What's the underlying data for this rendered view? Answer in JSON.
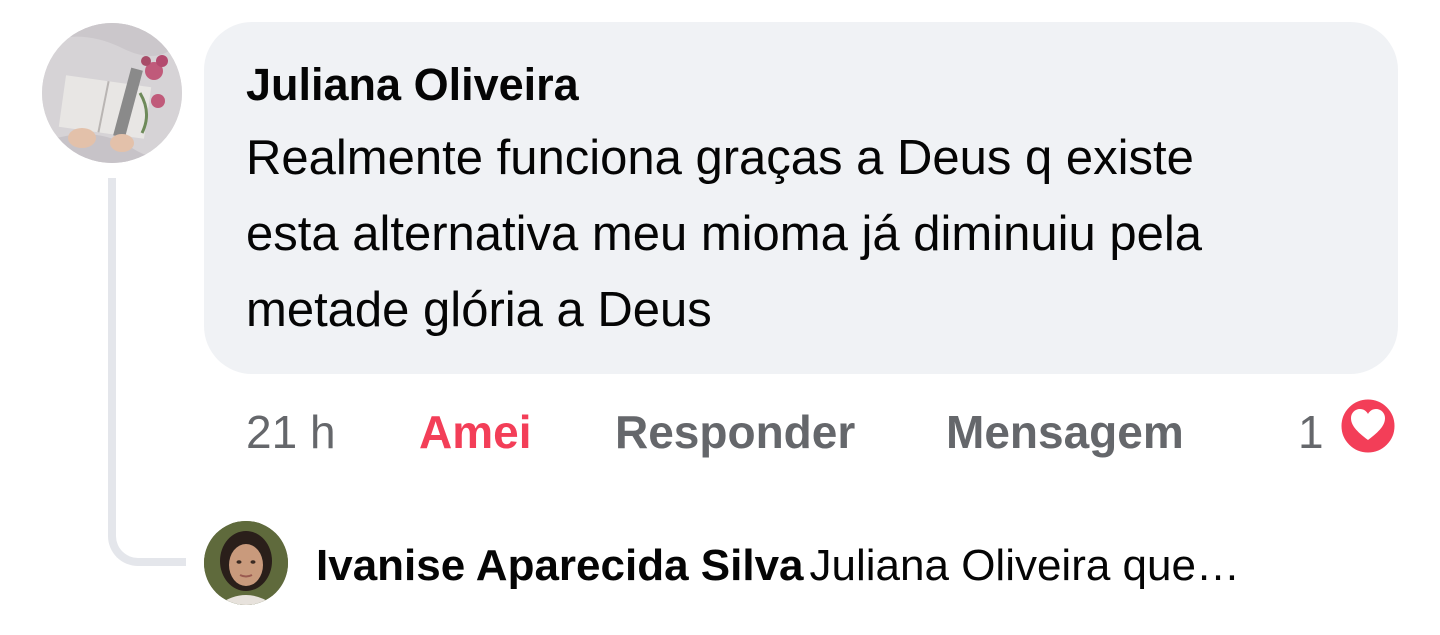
{
  "comment": {
    "author": "Juliana Oliveira",
    "text": "Realmente funciona graças a Deus q existe esta alternativa meu mioma já diminuiu pela metade glória a Deus",
    "avatar_icon": "open-book-flowers-avatar"
  },
  "actions": {
    "time": "21 h",
    "love_label": "Amei",
    "reply_label": "Responder",
    "message_label": "Mensagem",
    "love_color": "#f33e58"
  },
  "reactions": {
    "count": "1",
    "icon": "heart-icon",
    "color": "#f33e58"
  },
  "reply": {
    "author": "Ivanise Aparecida Silva",
    "text": "Juliana Oliveira que…",
    "avatar_icon": "person-avatar"
  }
}
